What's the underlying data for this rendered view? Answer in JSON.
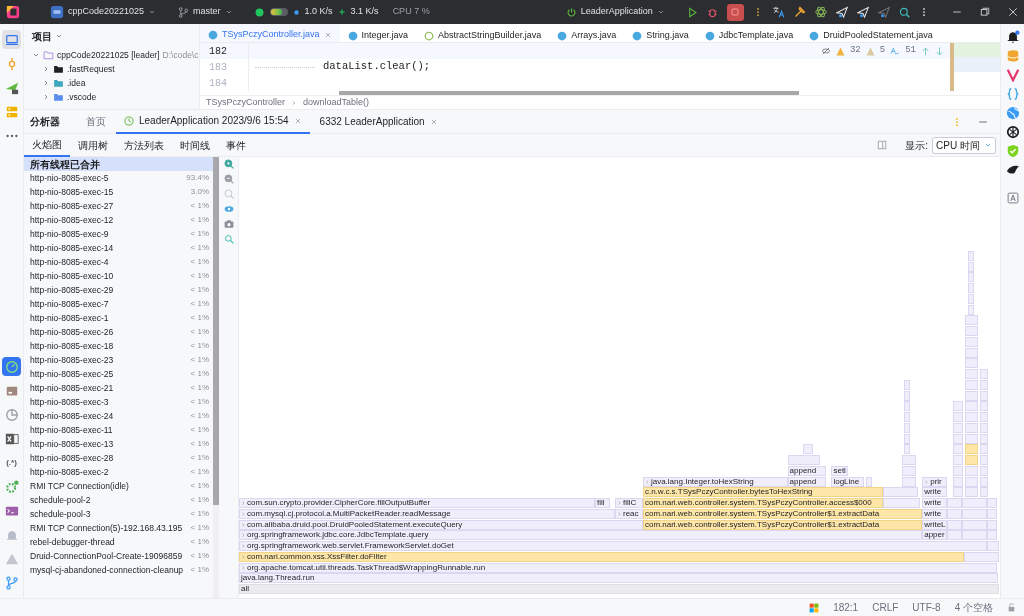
{
  "title_bar": {
    "project": "cppCode20221025",
    "branch": "master",
    "net_down": "1.0 K/s",
    "net_up": "3.1 K/s",
    "cpu": "CPU 7 %",
    "run_config": "LeaderApplication"
  },
  "left_strip": {
    "top": [
      {
        "selected": true
      },
      {
        "selected": false
      },
      {
        "selected": false
      },
      {
        "selected": false
      },
      {
        "selected": false
      }
    ],
    "bottom": [
      {
        "selected": true
      },
      {
        "selected": false
      },
      {
        "selected": false
      },
      {
        "selected": false
      },
      {
        "selected": false,
        "label": "(.*)"
      },
      {
        "selected": false
      },
      {
        "selected": false
      },
      {
        "selected": false
      },
      {
        "selected": false
      },
      {
        "selected": false
      }
    ]
  },
  "project_panel": {
    "title": "项目",
    "tree": [
      {
        "label": "cppCode20221025 [leader]",
        "path": "D:\\code\\c",
        "expanded": true,
        "children": [
          {
            "label": ".fastRequest",
            "expanded": false
          },
          {
            "label": ".idea",
            "expanded": false
          },
          {
            "label": ".vscode",
            "expanded": false
          }
        ]
      }
    ]
  },
  "editor": {
    "tabs": [
      {
        "label": "TSysPczyController.java",
        "kind": "class",
        "selected": true
      },
      {
        "label": "Integer.java",
        "kind": "class",
        "selected": false
      },
      {
        "label": "AbstractStringBuilder.java",
        "kind": "abstract",
        "selected": false
      },
      {
        "label": "Arrays.java",
        "kind": "class",
        "selected": false
      },
      {
        "label": "String.java",
        "kind": "class",
        "selected": false
      },
      {
        "label": "JdbcTemplate.java",
        "kind": "class",
        "selected": false
      },
      {
        "label": "DruidPooledStatement.java",
        "kind": "class",
        "selected": false
      }
    ],
    "lines": [
      {
        "number": "182",
        "current": true
      },
      {
        "number": "183",
        "code": "dataList.clear();",
        "current": false
      },
      {
        "number": "184",
        "current": false
      }
    ],
    "inspections": {
      "warnings": "32",
      "weak_warnings": "5",
      "typos": "51"
    },
    "breadcrumb": [
      "TSysPczyController",
      "downloadTable()"
    ]
  },
  "profiler": {
    "title": "分析器",
    "tabs": [
      {
        "label": "首页",
        "selected": false,
        "closable": false
      },
      {
        "label": "LeaderApplication 2023/9/6 15:54",
        "selected": true,
        "closable": true
      },
      {
        "label": "6332 LeaderApplication",
        "selected": false,
        "closable": true
      }
    ],
    "views": [
      {
        "label": "火焰图",
        "selected": true
      },
      {
        "label": "调用树",
        "selected": false
      },
      {
        "label": "方法列表",
        "selected": false
      },
      {
        "label": "时间线",
        "selected": false
      },
      {
        "label": "事件",
        "selected": false
      }
    ],
    "display_label": "显示:",
    "display_value": "CPU 时间",
    "threads": [
      {
        "name": "所有线程已合并",
        "selected": true
      },
      {
        "name": "http-nio-8085-exec-5",
        "share": "93.4%",
        "selected": false
      },
      {
        "name": "http-nio-8085-exec-15",
        "share": "3.0%",
        "selected": false
      },
      {
        "name": "http-nio-8085-exec-27",
        "share": "< 1%",
        "selected": false
      },
      {
        "name": "http-nio-8085-exec-12",
        "share": "< 1%",
        "selected": false
      },
      {
        "name": "http-nio-8085-exec-9",
        "share": "< 1%",
        "selected": false
      },
      {
        "name": "http-nio-8085-exec-14",
        "share": "< 1%",
        "selected": false
      },
      {
        "name": "http-nio-8085-exec-4",
        "share": "< 1%",
        "selected": false
      },
      {
        "name": "http-nio-8085-exec-10",
        "share": "< 1%",
        "selected": false
      },
      {
        "name": "http-nio-8085-exec-29",
        "share": "< 1%",
        "selected": false
      },
      {
        "name": "http-nio-8085-exec-7",
        "share": "< 1%",
        "selected": false
      },
      {
        "name": "http-nio-8085-exec-1",
        "share": "< 1%",
        "selected": false
      },
      {
        "name": "http-nio-8085-exec-26",
        "share": "< 1%",
        "selected": false
      },
      {
        "name": "http-nio-8085-exec-18",
        "share": "< 1%",
        "selected": false
      },
      {
        "name": "http-nio-8085-exec-23",
        "share": "< 1%",
        "selected": false
      },
      {
        "name": "http-nio-8085-exec-25",
        "share": "< 1%",
        "selected": false
      },
      {
        "name": "http-nio-8085-exec-21",
        "share": "< 1%",
        "selected": false
      },
      {
        "name": "http-nio-8085-exec-3",
        "share": "< 1%",
        "selected": false
      },
      {
        "name": "http-nio-8085-exec-24",
        "share": "< 1%",
        "selected": false
      },
      {
        "name": "http-nio-8085-exec-11",
        "share": "< 1%",
        "selected": false
      },
      {
        "name": "http-nio-8085-exec-13",
        "share": "< 1%",
        "selected": false
      },
      {
        "name": "http-nio-8085-exec-28",
        "share": "< 1%",
        "selected": false
      },
      {
        "name": "http-nio-8085-exec-2",
        "share": "< 1%",
        "selected": false
      },
      {
        "name": "RMI TCP Connection(idle)",
        "share": "< 1%",
        "selected": false
      },
      {
        "name": "schedule-pool-2",
        "share": "< 1%",
        "selected": false
      },
      {
        "name": "schedule-pool-3",
        "share": "< 1%",
        "selected": false
      },
      {
        "name": "RMI TCP Connection(5)-192.168.43.195",
        "share": "< 1%",
        "selected": false
      },
      {
        "name": "rebel-debugger-thread",
        "share": "< 1%",
        "selected": false
      },
      {
        "name": "Druid-ConnectionPool-Create-19096859",
        "share": "< 1%",
        "selected": false
      },
      {
        "name": "mysql-cj-abandoned-connection-cleanup",
        "share": "< 1%",
        "selected": false
      }
    ],
    "flame_frames": [
      {
        "label": "append",
        "kind": "method",
        "highlighted": false,
        "collapsed": false
      },
      {
        "label": "setl",
        "kind": "method",
        "highlighted": false,
        "collapsed": false
      },
      {
        "label": "java.lang.Integer.toHexString",
        "kind": "method",
        "highlighted": false,
        "collapsed": true
      },
      {
        "label": "append",
        "kind": "method",
        "highlighted": false,
        "collapsed": false
      },
      {
        "label": "logLine",
        "kind": "method",
        "highlighted": false,
        "collapsed": false
      },
      {
        "label": "prir",
        "kind": "method",
        "highlighted": false,
        "collapsed": true
      },
      {
        "label": "c.n.w.c.s.TSysPczyController.bytesToHexString",
        "kind": "method",
        "highlighted": true,
        "collapsed": false
      },
      {
        "label": "write",
        "kind": "method",
        "highlighted": false,
        "collapsed": false
      },
      {
        "label": "com.sun.crypto.provider.CipherCore.fillOutputBuffer",
        "kind": "method",
        "highlighted": false,
        "collapsed": true
      },
      {
        "label": "fill",
        "kind": "method",
        "highlighted": false,
        "collapsed": false
      },
      {
        "label": "fillC",
        "kind": "method",
        "highlighted": false,
        "collapsed": true
      },
      {
        "label": "com.nari.web.controller.system.TSysPczyController.access$000",
        "kind": "method",
        "highlighted": true,
        "collapsed": false
      },
      {
        "label": "write",
        "kind": "method",
        "highlighted": false,
        "collapsed": false
      },
      {
        "label": "com.mysql.cj.protocol.a.MultiPacketReader.readMessage",
        "kind": "method",
        "highlighted": false,
        "collapsed": true
      },
      {
        "label": "reac",
        "kind": "method",
        "highlighted": false,
        "collapsed": true
      },
      {
        "label": "com.nari.web.controller.system.TSysPczyController$1.extractData",
        "kind": "method",
        "highlighted": true,
        "collapsed": false
      },
      {
        "label": "write",
        "kind": "method",
        "highlighted": false,
        "collapsed": false
      },
      {
        "label": "com.alibaba.druid.pool.DruidPooledStatement.executeQuery",
        "kind": "method",
        "highlighted": false,
        "collapsed": true
      },
      {
        "label": "com.nari.web.controller.system.TSysPczyController$1.extractData",
        "kind": "method",
        "highlighted": true,
        "collapsed": false
      },
      {
        "label": "writeL",
        "kind": "method",
        "highlighted": false,
        "collapsed": false
      },
      {
        "label": "org.springframework.jdbc.core.JdbcTemplate.query",
        "kind": "method",
        "highlighted": false,
        "collapsed": true
      },
      {
        "label": "apper",
        "kind": "method",
        "highlighted": false,
        "collapsed": false
      },
      {
        "label": "org.springframework.web.servlet.FrameworkServlet.doGet",
        "kind": "method",
        "highlighted": false,
        "collapsed": true
      },
      {
        "label": "com.nari.common.xss.XssFilter.doFilter",
        "kind": "method",
        "highlighted": true,
        "collapsed": true
      },
      {
        "label": "org.apache.tomcat.util.threads.TaskThread$WrappingRunnable.run",
        "kind": "method",
        "highlighted": false,
        "collapsed": true
      },
      {
        "label": "java.lang.Thread.run",
        "kind": "method",
        "highlighted": false,
        "collapsed": false
      },
      {
        "label": "all",
        "kind": "root",
        "highlighted": false,
        "collapsed": false
      }
    ]
  },
  "status_bar": [
    "182:1",
    "CRLF",
    "UTF-8",
    "4 个空格"
  ]
}
